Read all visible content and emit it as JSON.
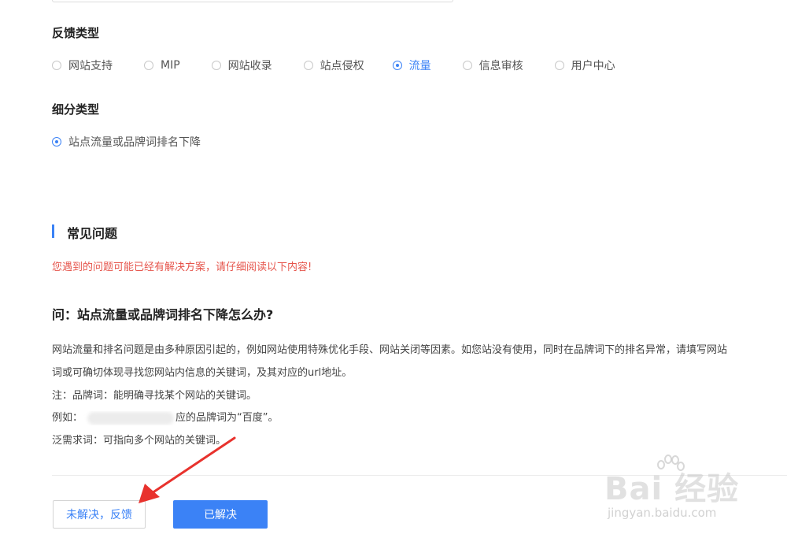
{
  "feedback_type": {
    "title": "反馈类型",
    "options": [
      "网站支持",
      "MIP",
      "网站收录",
      "站点侵权",
      "流量",
      "信息审核",
      "用户中心"
    ],
    "selected": "流量"
  },
  "sub_type": {
    "title": "细分类型",
    "options": [
      "站点流量或品牌词排名下降"
    ],
    "selected": "站点流量或品牌词排名下降"
  },
  "faq": {
    "title": "常见问题",
    "notice": "您遇到的问题可能已经有解决方案，请仔细阅读以下内容!",
    "question": "问：站点流量或品牌词排名下降怎么办?",
    "lines": [
      "网站流量和排名问题是由多种原因引起的，例如网站使用特殊优化手段、网站关闭等因素。如您站没有使用，同时在品牌词下的排名异常，请填写网站",
      "词或可确切体现寻找您网站内信息的关键词，及其对应的url地址。",
      "注：品牌词：能明确寻找某个网站的关键词。",
      "泛需求词：可指向多个网站的关键词。"
    ],
    "example_prefix": "例如：",
    "example_suffix": "应的品牌词为“百度”。"
  },
  "buttons": {
    "unsolved": "未解决，反馈",
    "solved": "已解决"
  },
  "watermark": {
    "main": "Bai  经验",
    "sub": "jingyan.baidu.com"
  },
  "colors": {
    "accent": "#3b82f6",
    "notice": "#e6554c",
    "arrow": "#e8322d"
  }
}
